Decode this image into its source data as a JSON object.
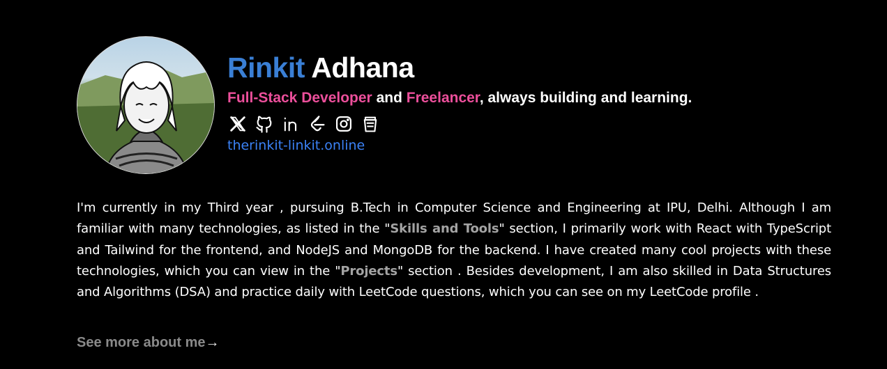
{
  "profile": {
    "first_name": "Rinkit",
    "last_name": "Adhana",
    "role1": "Full-Stack Developer",
    "conj": " and ",
    "role2": "Freelancer",
    "tagline_rest": ", always building and learning.",
    "website": "therinkit-linkit.online",
    "avatar_icon": "anime-portrait-avatar"
  },
  "socials": [
    {
      "name": "x-icon"
    },
    {
      "name": "github-icon"
    },
    {
      "name": "linkedin-icon"
    },
    {
      "name": "leetcode-icon"
    },
    {
      "name": "instagram-icon"
    },
    {
      "name": "coffee-cup-icon"
    }
  ],
  "bio": {
    "p1": "I'm currently in my Third year , pursuing B.Tech in Computer Science and Engineering at IPU, Delhi. Although I am familiar with many technologies, as listed in the \"",
    "link1": "Skills and Tools",
    "p2": "\" section, I primarily work with React with TypeScript and Tailwind for the frontend, and NodeJS and MongoDB for the backend. I have created many cool projects with these technologies, which you can view in the \"",
    "link2": "Projects",
    "p3": "\" section . Besides development, I am also skilled in Data Structures and Algorithms (DSA) and practice daily with LeetCode questions, which you can see on my LeetCode profile ."
  },
  "see_more": {
    "label": "See more about me",
    "arrow": "→"
  },
  "colors": {
    "accent_blue": "#3a7fd5",
    "pink": "#ec4f9b",
    "link_blue": "#3b82f6",
    "background": "#000000"
  }
}
